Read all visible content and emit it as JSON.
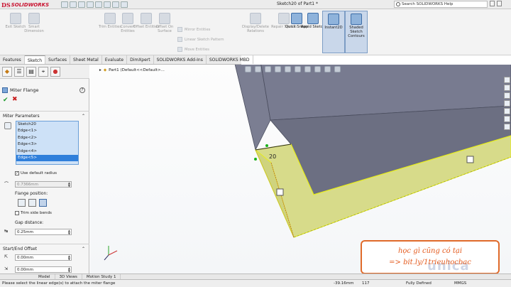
{
  "app": {
    "brand_ds": "DS",
    "brand_name": "SOLIDWORKS",
    "window_title": "Sketch20 of Part1 *",
    "help_search": "Search SOLIDWORKS Help"
  },
  "ribbon": {
    "buttons": [
      {
        "label": "Exit Sketch",
        "on": false
      },
      {
        "label": "Smart Dimension",
        "on": false
      },
      {
        "label": "Trim Entities",
        "on": false
      },
      {
        "label": "Convert Entities",
        "on": false
      },
      {
        "label": "Offset Entities",
        "on": false
      },
      {
        "label": "Offset On Surface",
        "on": false
      },
      {
        "label": "Display/Delete Relations",
        "on": false
      },
      {
        "label": "Repair Sketch",
        "on": false
      },
      {
        "label": "Quick Snaps",
        "on": false
      },
      {
        "label": "Rapid Sketch",
        "on": true
      },
      {
        "label": "Instant2D",
        "on": true
      },
      {
        "label": "Shaded Sketch Contours",
        "on": true
      }
    ],
    "mirror": "Mirror Entities",
    "linear_pattern": "Linear Sketch Pattern",
    "move": "Move Entities"
  },
  "tabs": [
    "Features",
    "Sketch",
    "Surfaces",
    "Sheet Metal",
    "Evaluate",
    "DimXpert",
    "SOLIDWORKS Add-Ins",
    "SOLIDWORKS MBD"
  ],
  "tab_active": "Sketch",
  "feature_tree_icons": [
    "feature-manager",
    "property-manager",
    "configuration-manager",
    "dimxpert-manager",
    "display-manager"
  ],
  "property_manager": {
    "title": "Miter Flange",
    "help": "?",
    "ok": "✔",
    "cancel": "✖",
    "miter_params": {
      "title": "Miter Parameters",
      "items": [
        "Sketch20",
        "Edge<1>",
        "Edge<2>",
        "Edge<3>",
        "Edge<4>",
        "Edge<5>"
      ],
      "selected": 5
    },
    "use_default_radius": "Use default radius",
    "radius": "0.7366mm",
    "flange_position": "Flange position:",
    "trim_side_bends": "Trim side bends",
    "gap_distance_label": "Gap distance:",
    "gap_distance": "0.25mm",
    "start_end_offset": "Start/End Offset",
    "start_offset": "0.00mm",
    "end_offset": "0.00mm"
  },
  "viewport": {
    "tree_label": "Part1  (Default<<Default>...",
    "dimension": "20"
  },
  "bottom_tabs": [
    "Model",
    "3D Views",
    "Motion Study 1"
  ],
  "status": {
    "message": "Please select the linear edge(s) to attach the miter flange",
    "x": "-39.16mm",
    "y": "117",
    "state": "Fully Defined",
    "units": "MMGS"
  },
  "watermark": {
    "line1": "học gì cũng có tại",
    "line2": "=> bit.ly/1trieuhocbac",
    "brand": "unica"
  },
  "colors": {
    "flange_face": "#d7db8a",
    "flange_edge": "#e8ee1a",
    "body_face": "#7c7f92",
    "accent": "#2f7fdb"
  }
}
